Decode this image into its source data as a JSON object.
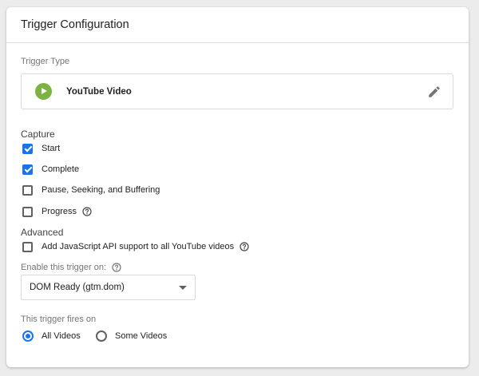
{
  "header": {
    "title": "Trigger Configuration"
  },
  "trigger_type": {
    "label": "Trigger Type",
    "name": "YouTube Video",
    "icon": "play-circle-icon",
    "icon_color": "#7cb342",
    "edit_icon": "pencil-icon"
  },
  "capture": {
    "label": "Capture",
    "options": [
      {
        "label": "Start",
        "checked": true
      },
      {
        "label": "Complete",
        "checked": true
      },
      {
        "label": "Pause, Seeking, and Buffering",
        "checked": false
      },
      {
        "label": "Progress",
        "checked": false,
        "help": true
      }
    ]
  },
  "advanced": {
    "label": "Advanced",
    "js_api": {
      "label": "Add JavaScript API support to all YouTube videos",
      "checked": false,
      "help": true
    }
  },
  "enable_on": {
    "label": "Enable this trigger on:",
    "value": "DOM Ready (gtm.dom)"
  },
  "fires_on": {
    "label": "This trigger fires on",
    "options": [
      {
        "label": "All Videos",
        "selected": true
      },
      {
        "label": "Some Videos",
        "selected": false
      }
    ]
  },
  "colors": {
    "accent": "#1a73e8",
    "play_green": "#7cb342"
  }
}
